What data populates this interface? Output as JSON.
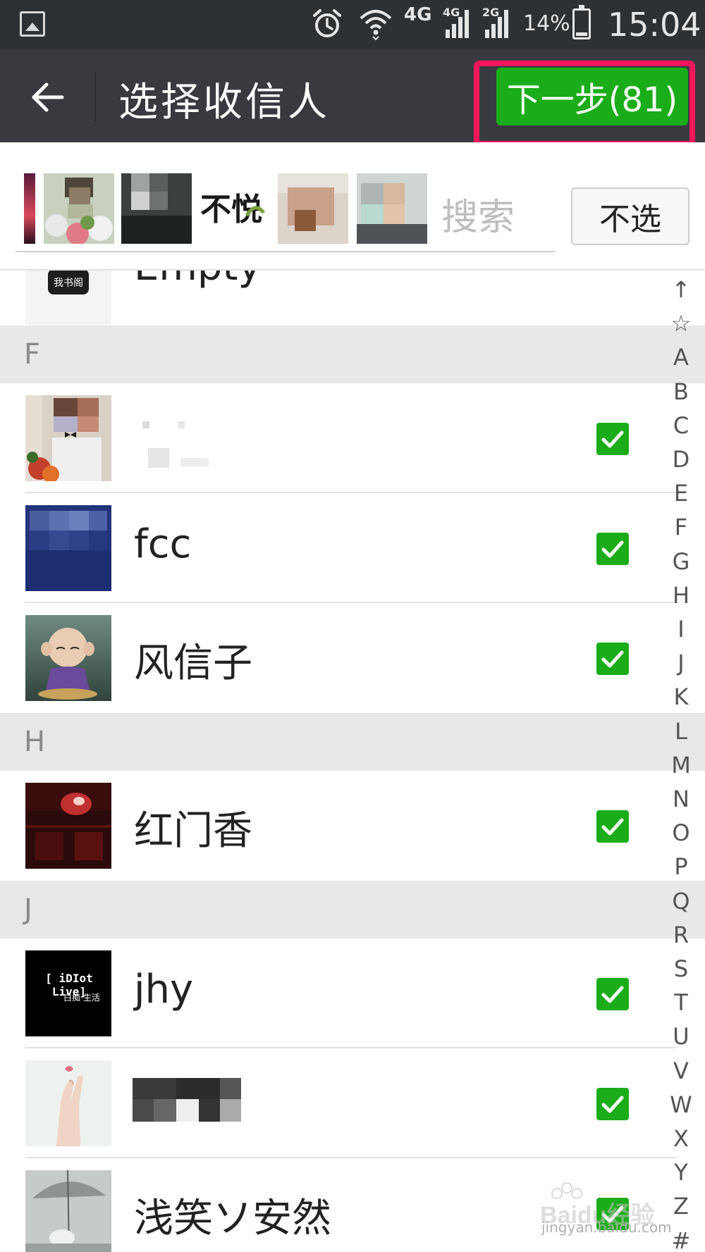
{
  "status_bar": {
    "network_4g": "4G",
    "sig1_label": "4G",
    "sig2_label": "2G",
    "battery": "14%",
    "battery_level": 0.14,
    "time": "15:04"
  },
  "title_bar": {
    "title": "选择收信人",
    "next_button": "下一步(81)"
  },
  "selector": {
    "search_placeholder": "搜索",
    "deselect_button": "不选",
    "selected_avatars": [
      {
        "kind": "sunset-partial"
      },
      {
        "kind": "flowers-blurred"
      },
      {
        "kind": "dark-blurred"
      },
      {
        "kind": "calligraphy",
        "text": "不悦"
      },
      {
        "kind": "baby-blurred"
      },
      {
        "kind": "person-blurred"
      }
    ]
  },
  "list": {
    "first_partial": {
      "name": "Empty",
      "avatar_text": "我书阁"
    },
    "sections": [
      {
        "letter": "F",
        "contacts": [
          {
            "name": "",
            "checked": true,
            "avatar": "groom"
          },
          {
            "name": "fcc",
            "checked": true,
            "avatar": "blue-pixel"
          },
          {
            "name": "风信子",
            "checked": true,
            "avatar": "monk-doll"
          }
        ]
      },
      {
        "letter": "H",
        "contacts": [
          {
            "name": "红门香",
            "checked": true,
            "avatar": "red-dark"
          }
        ]
      },
      {
        "letter": "J",
        "contacts": [
          {
            "name": "jhy",
            "checked": true,
            "avatar": "idiot-live",
            "avatar_text_1": "[ iDIot Live]",
            "avatar_text_2": "白痴 生活"
          },
          {
            "name": "",
            "checked": true,
            "avatar": "hand"
          },
          {
            "name": "浅笑ソ安然",
            "checked": true,
            "avatar": "umbrella"
          }
        ]
      }
    ]
  },
  "alpha_index": [
    "↑",
    "☆",
    "A",
    "B",
    "C",
    "D",
    "E",
    "F",
    "G",
    "H",
    "I",
    "J",
    "K",
    "L",
    "M",
    "N",
    "O",
    "P",
    "Q",
    "R",
    "S",
    "T",
    "U",
    "V",
    "W",
    "X",
    "Y",
    "Z",
    "#"
  ],
  "watermark": {
    "text": "jingyan.baidu.com",
    "logo": "Baidu经验"
  },
  "colors": {
    "status_bg": "#2e3133",
    "title_bg": "#393a3f",
    "accent_green": "#1aad19",
    "highlight": "#f4165c",
    "section_bg": "#e8e8e8"
  }
}
